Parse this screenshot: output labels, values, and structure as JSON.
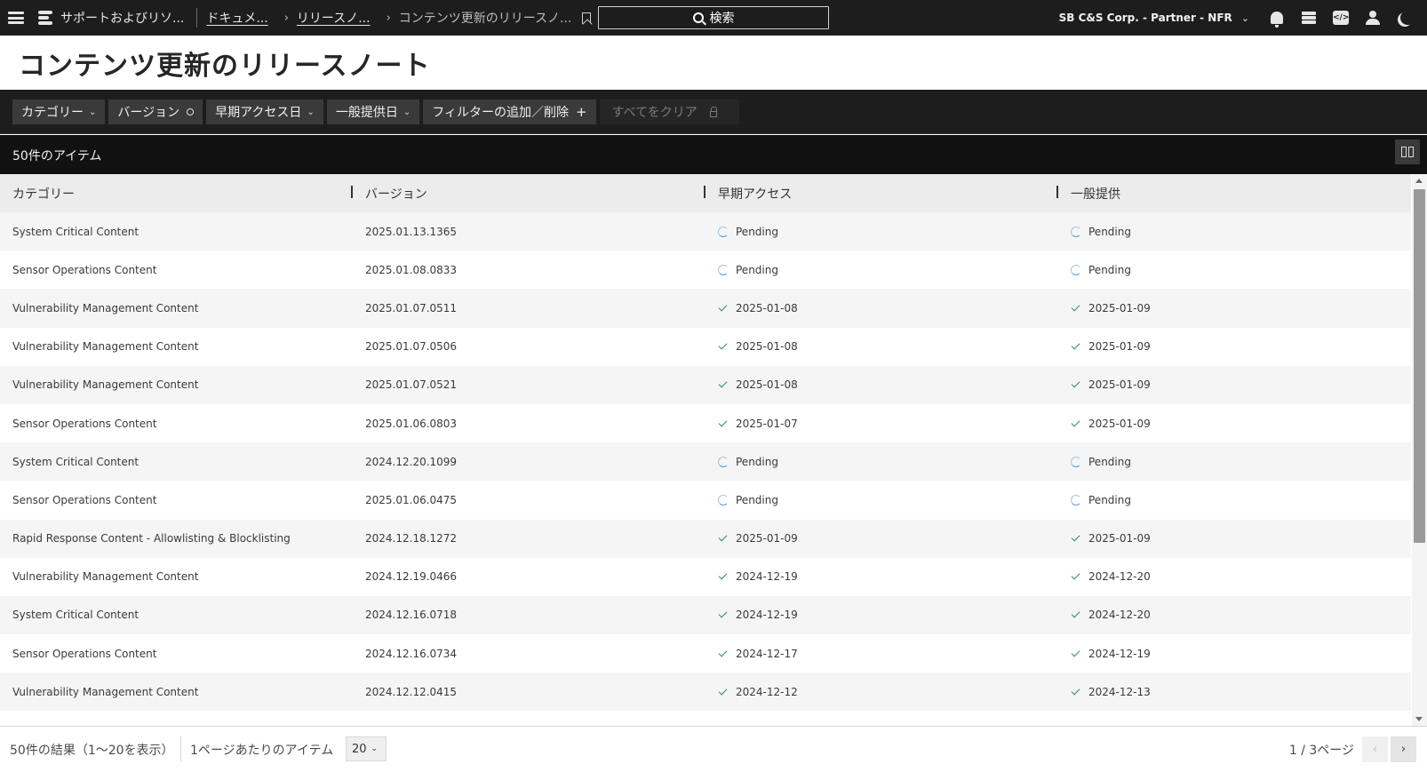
{
  "topbar": {
    "site": "サポートおよびリソ...",
    "crumbs": [
      "ドキュメ...",
      "リリースノ..."
    ],
    "current": "コンテンツ更新のリリースノ...",
    "search_label": "検索",
    "account": "SB C&S Corp. - Partner - NFR"
  },
  "page": {
    "title": "コンテンツ更新のリリースノート"
  },
  "filters": {
    "category": "カテゴリー",
    "version": "バージョン",
    "early_access": "早期アクセス日",
    "general": "一般提供日",
    "add_remove": "フィルターの追加／削除",
    "clear_all": "すべてをクリア"
  },
  "summary": {
    "count": "50件のアイテム"
  },
  "table": {
    "headers": [
      "カテゴリー",
      "バージョン",
      "早期アクセス",
      "一般提供"
    ],
    "rows": [
      {
        "category": "System Critical Content",
        "version": "2025.01.13.1365",
        "early": "Pending",
        "early_status": "pending",
        "ga": "Pending",
        "ga_status": "pending"
      },
      {
        "category": "Sensor Operations Content",
        "version": "2025.01.08.0833",
        "early": "Pending",
        "early_status": "pending",
        "ga": "Pending",
        "ga_status": "pending"
      },
      {
        "category": "Vulnerability Management Content",
        "version": "2025.01.07.0511",
        "early": "2025-01-08",
        "early_status": "done",
        "ga": "2025-01-09",
        "ga_status": "done"
      },
      {
        "category": "Vulnerability Management Content",
        "version": "2025.01.07.0506",
        "early": "2025-01-08",
        "early_status": "done",
        "ga": "2025-01-09",
        "ga_status": "done"
      },
      {
        "category": "Vulnerability Management Content",
        "version": "2025.01.07.0521",
        "early": "2025-01-08",
        "early_status": "done",
        "ga": "2025-01-09",
        "ga_status": "done"
      },
      {
        "category": "Sensor Operations Content",
        "version": "2025.01.06.0803",
        "early": "2025-01-07",
        "early_status": "done",
        "ga": "2025-01-09",
        "ga_status": "done"
      },
      {
        "category": "System Critical Content",
        "version": "2024.12.20.1099",
        "early": "Pending",
        "early_status": "pending",
        "ga": "Pending",
        "ga_status": "pending"
      },
      {
        "category": "Sensor Operations Content",
        "version": "2025.01.06.0475",
        "early": "Pending",
        "early_status": "pending",
        "ga": "Pending",
        "ga_status": "pending"
      },
      {
        "category": "Rapid Response Content - Allowlisting & Blocklisting",
        "version": "2024.12.18.1272",
        "early": "2025-01-09",
        "early_status": "done",
        "ga": "2025-01-09",
        "ga_status": "done"
      },
      {
        "category": "Vulnerability Management Content",
        "version": "2024.12.19.0466",
        "early": "2024-12-19",
        "early_status": "done",
        "ga": "2024-12-20",
        "ga_status": "done"
      },
      {
        "category": "System Critical Content",
        "version": "2024.12.16.0718",
        "early": "2024-12-19",
        "early_status": "done",
        "ga": "2024-12-20",
        "ga_status": "done"
      },
      {
        "category": "Sensor Operations Content",
        "version": "2024.12.16.0734",
        "early": "2024-12-17",
        "early_status": "done",
        "ga": "2024-12-19",
        "ga_status": "done"
      },
      {
        "category": "Vulnerability Management Content",
        "version": "2024.12.12.0415",
        "early": "2024-12-12",
        "early_status": "done",
        "ga": "2024-12-13",
        "ga_status": "done"
      }
    ]
  },
  "footer": {
    "results": "50件の結果（1〜20を表示）",
    "per_page_label": "1ページあたりのアイテム",
    "per_page_value": "20",
    "page_info": "1 / 3ページ"
  },
  "colors": {
    "topbar": "#1d1d1d",
    "check": "#2e8b57",
    "pending": "#5a9bd5"
  }
}
